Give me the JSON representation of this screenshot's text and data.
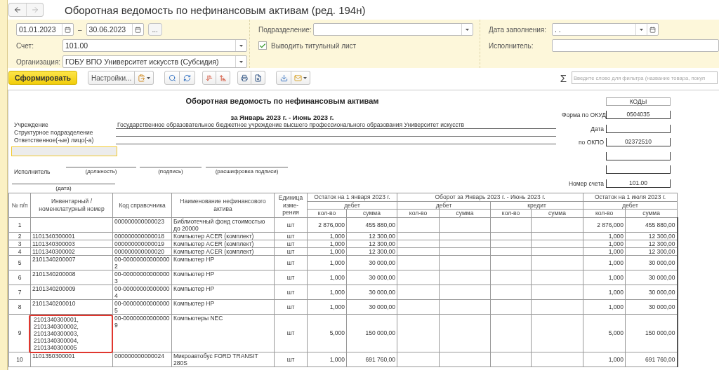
{
  "window": {
    "title": "Оборотная ведомость по нефинансовым активам (ред. 194н)"
  },
  "nav": {
    "back_enabled": true,
    "forward_enabled": false
  },
  "filters": {
    "date_from": "01.01.2023",
    "date_separator": "–",
    "date_to": "30.06.2023",
    "period_button": "...",
    "account": {
      "label": "Счет:",
      "value": "101.00"
    },
    "organization": {
      "label": "Организация:",
      "value": "ГОБУ ВПО Университет искусств (Субсидия)"
    },
    "department": {
      "label": "Подразделение:"
    },
    "title_page": {
      "label": "Выводить титульный лист",
      "checked": true
    },
    "fill_date": {
      "label": "Дата заполнения:",
      "value": ". ."
    },
    "executor": {
      "label": "Исполнитель:"
    }
  },
  "toolbar": {
    "generate": "Сформировать",
    "settings": "Настройки...",
    "sigma": "Σ",
    "search": {
      "placeholder": "Введите слово для фильтра (название товара, покуп"
    }
  },
  "report": {
    "title": "Оборотная ведомость по нефинансовым активам",
    "period": "за Январь 2023 г. - Июнь 2023 г.",
    "fields": [
      {
        "label": "Учреждение",
        "value": "Государственное образовательное бюджетное учреждение высшего профессионального образования Университет искусств"
      },
      {
        "label": "Структурное подразделение"
      },
      {
        "label": "Ответственное(-ые) лицо(-а)"
      }
    ],
    "signature": {
      "label": "Исполнитель",
      "captions": [
        "(должность)",
        "(подпись)",
        "(расшифровка подписи)"
      ],
      "date_caption": "(дата)"
    },
    "codes_header": "КОДЫ",
    "codes": [
      {
        "label": "Форма по ОКУД",
        "value": "0504035"
      },
      {
        "label": "Дата"
      },
      {
        "label": "по ОКПО",
        "value": "02372510"
      },
      {
        "label": "Номер счета",
        "value": "101.00"
      }
    ]
  },
  "table": {
    "columns": [
      {
        "label": "№ п/п"
      },
      {
        "label": "Инвентарный / номенклатурный номер"
      },
      {
        "label": "Код справочника"
      },
      {
        "label": "Наименование нефинансового актива"
      },
      {
        "label_lines": [
          "Единица",
          "изме-",
          "рения"
        ]
      }
    ],
    "groups": [
      {
        "label": "Остаток на 1 января 2023 г.",
        "sides": [
          {
            "label": "дебет",
            "subcolumns": [
              "кол-во",
              "сумма"
            ]
          }
        ]
      },
      {
        "label": "Оборот за Январь 2023 г. - Июнь 2023 г.",
        "sides": [
          {
            "label": "дебет",
            "subcolumns": [
              "кол-во",
              "сумма"
            ]
          },
          {
            "label": "кредит",
            "subcolumns": [
              "кол-во",
              "сумма"
            ]
          }
        ]
      },
      {
        "label": "Остаток на 1 июля 2023 г.",
        "sides": [
          {
            "label": "дебет",
            "subcolumns": [
              "кол-во",
              "сумма"
            ]
          }
        ]
      }
    ],
    "rows": [
      {
        "number": "1",
        "code": "000000000000023",
        "name": "Библиотечный фонд стоимостью до 20000",
        "unit": "шт",
        "opening_qty": "2 876,000",
        "opening_sum": "455 880,00",
        "closing_qty": "2 876,000",
        "closing_sum": "455 880,00",
        "highlighted": false
      },
      {
        "number": "2",
        "inventory": "1101340300001",
        "code": "000000000000018",
        "name": "Компьютер ACER (комплект)",
        "unit": "шт",
        "opening_qty": "1,000",
        "opening_sum": "12 300,00",
        "closing_qty": "1,000",
        "closing_sum": "12 300,00",
        "highlighted": false
      },
      {
        "number": "3",
        "inventory": "1101340300003",
        "code": "000000000000019",
        "name": "Компьютер ACER (комплект)",
        "unit": "шт",
        "opening_qty": "1,000",
        "opening_sum": "12 300,00",
        "closing_qty": "1,000",
        "closing_sum": "12 300,00",
        "highlighted": false
      },
      {
        "number": "4",
        "inventory": "1101340300002",
        "code": "000000000000020",
        "name": "Компьютер ACER (комплект)",
        "unit": "шт",
        "opening_qty": "1,000",
        "opening_sum": "12 300,00",
        "closing_qty": "1,000",
        "closing_sum": "12 300,00",
        "highlighted": false
      },
      {
        "number": "5",
        "inventory": "2101340200007",
        "code": "00-000000000000002",
        "name": "Компьютер HP",
        "unit": "шт",
        "opening_qty": "1,000",
        "opening_sum": "30 000,00",
        "closing_qty": "1,000",
        "closing_sum": "30 000,00",
        "highlighted": false
      },
      {
        "number": "6",
        "inventory": "2101340200008",
        "code": "00-000000000000003",
        "name": "Компьютер HP",
        "unit": "шт",
        "opening_qty": "1,000",
        "opening_sum": "30 000,00",
        "closing_qty": "1,000",
        "closing_sum": "30 000,00",
        "highlighted": false
      },
      {
        "number": "7",
        "inventory": "2101340200009",
        "code": "00-000000000000004",
        "name": "Компьютер HP",
        "unit": "шт",
        "opening_qty": "1,000",
        "opening_sum": "30 000,00",
        "closing_qty": "1,000",
        "closing_sum": "30 000,00",
        "highlighted": false
      },
      {
        "number": "8",
        "inventory": "2101340200010",
        "code": "00-000000000000005",
        "name": "Компьютер HP",
        "unit": "шт",
        "opening_qty": "1,000",
        "opening_sum": "30 000,00",
        "closing_qty": "1,000",
        "closing_sum": "30 000,00",
        "highlighted": false
      },
      {
        "number": "9",
        "inventory": "2101340300001, 2101340300002, 2101340300003, 2101340300004, 2101340300005",
        "code": "00-000000000000009",
        "name": "Компьютеры NEC",
        "unit": "шт",
        "opening_qty": "5,000",
        "opening_sum": "150 000,00",
        "closing_qty": "5,000",
        "closing_sum": "150 000,00",
        "highlighted": true
      },
      {
        "number": "10",
        "inventory": "1101350300001",
        "code": "000000000000024",
        "name": "Микроавтобус FORD TRANSIT 280S",
        "unit": "шт",
        "opening_qty": "1,000",
        "opening_sum": "691 760,00",
        "closing_qty": "1,000",
        "closing_sum": "691 760,00",
        "highlighted": false
      }
    ]
  }
}
